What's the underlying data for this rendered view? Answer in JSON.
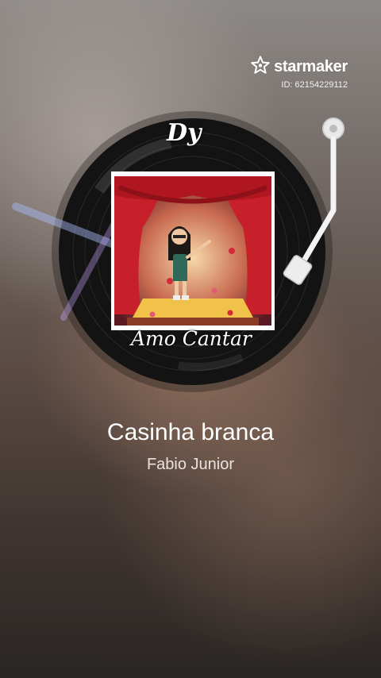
{
  "app": {
    "brand_name": "starmaker",
    "user_id": "ID: 62154229112",
    "logo_icon": "star-logo-icon"
  },
  "record": {
    "top_label": "Dy",
    "bottom_label": "Amo Cantar"
  },
  "song": {
    "title": "Casinha branca",
    "artist": "Fabio Junior"
  },
  "colors": {
    "curtain": "#c8202a",
    "stage_floor": "#f1c24a",
    "record": "#151414"
  }
}
